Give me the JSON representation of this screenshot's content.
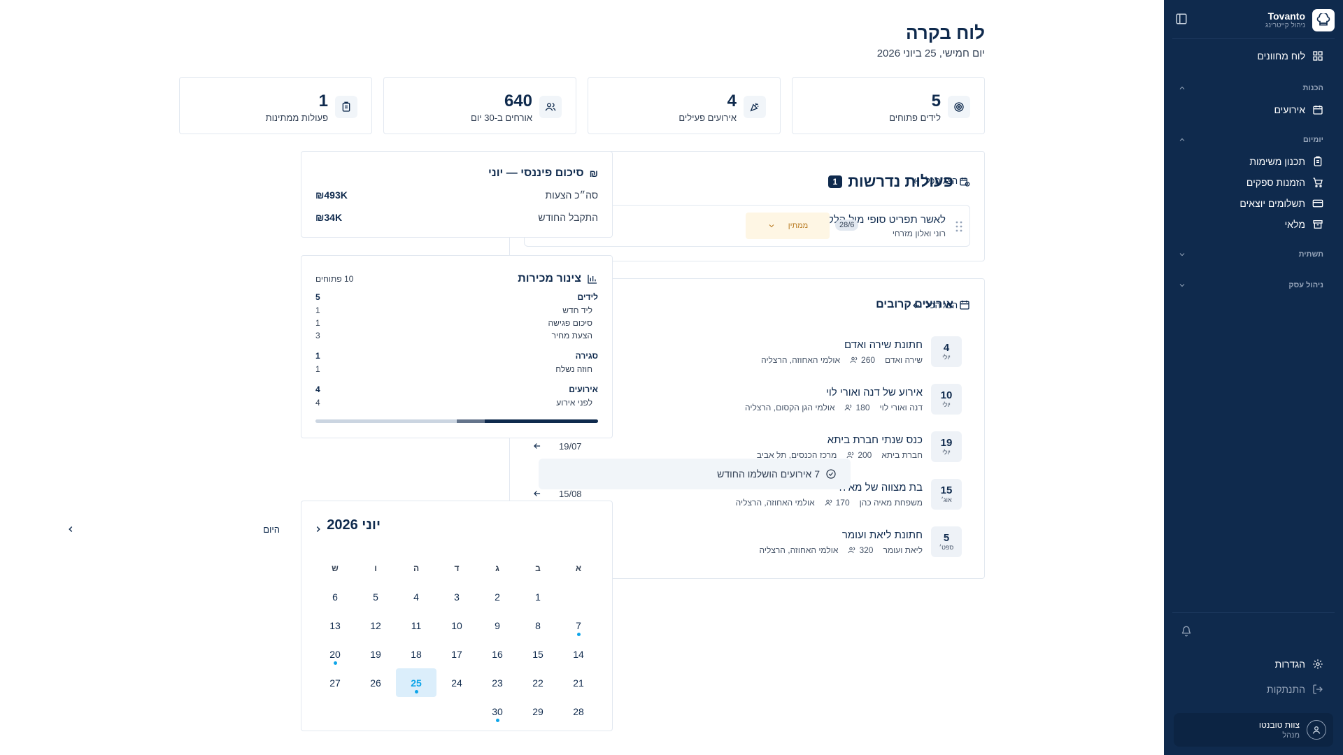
{
  "sidebar": {
    "brand_name": "Tovanto",
    "brand_sub": "ניהול קייטרינג",
    "dashboard_label": "לוח מחוונים",
    "sections": [
      {
        "title": "הכנות",
        "items": [
          {
            "label": "אירועים",
            "icon": "calendar-icon"
          }
        ]
      },
      {
        "title": "יומיום",
        "items": [
          {
            "label": "תכנון משימות",
            "icon": "clipboard-icon"
          },
          {
            "label": "הזמנות ספקים",
            "icon": "cart-icon"
          },
          {
            "label": "תשלומים יוצאים",
            "icon": "credit-card-icon"
          },
          {
            "label": "מלאי",
            "icon": "archive-icon"
          }
        ]
      },
      {
        "title": "תשתית",
        "items": []
      },
      {
        "title": "ניהול עסק",
        "items": []
      }
    ],
    "settings_label": "הגדרות",
    "logout_label": "התנתקות",
    "user_name": "צוות טובנטו",
    "user_role": "מנהל"
  },
  "header": {
    "title": "לוח בקרה",
    "date": "יום חמישי, 25 ביוני 2026"
  },
  "kpis": [
    {
      "value": "5",
      "label": "לידים פתוחים",
      "icon": "target-icon"
    },
    {
      "value": "4",
      "label": "אירועים פעילים",
      "icon": "party-popper-icon"
    },
    {
      "value": "640",
      "label": "אורחים ב-30 יום",
      "icon": "users-icon"
    },
    {
      "value": "1",
      "label": "פעולות ממתינות",
      "icon": "clipboard-icon"
    }
  ],
  "actions": {
    "title": "פעולות נדרשות",
    "count": "1",
    "show_all": "הצג הכל",
    "items": [
      {
        "title": "לאשר תפריט סופי מול הלקוח",
        "subtitle": "רוני ואלון מזרחי",
        "date": "28/6",
        "status": "ממתין"
      }
    ]
  },
  "upcoming": {
    "title": "אירועים קרובים",
    "show_all": "הצג הכל",
    "items": [
      {
        "day": "4",
        "month": "יולי",
        "title": "חתונת שירה ואדם",
        "client": "שירה ואדם",
        "guests": "260",
        "venue": "אולמי האחוזה, הרצליה",
        "date": "04/07"
      },
      {
        "day": "10",
        "month": "יולי",
        "title": "אירוע של דנה ואורי לוי",
        "client": "דנה ואורי לוי",
        "guests": "180",
        "venue": "אולמי הגן הקסום, הרצליה",
        "date": "10/07"
      },
      {
        "day": "19",
        "month": "יולי",
        "title": "כנס שנתי חברת ביתא",
        "client": "חברת ביתא",
        "guests": "200",
        "venue": "מרכז הכנסים, תל אביב",
        "date": "19/07"
      },
      {
        "day": "15",
        "month": "אוג׳",
        "title": "בת מצווה של מאיה",
        "client": "משפחת מאיה כהן",
        "guests": "170",
        "venue": "אולמי האחוזה, הרצליה",
        "date": "15/08"
      },
      {
        "day": "5",
        "month": "ספט׳",
        "title": "חתונת ליאת ועומר",
        "client": "ליאת ועומר",
        "guests": "320",
        "venue": "אולמי האחוזה, הרצליה",
        "date": "05/09"
      }
    ]
  },
  "finance": {
    "title": "סיכום פיננסי — יוני",
    "rows": [
      {
        "label": "סה״כ הצעות",
        "amount": "₪493K"
      },
      {
        "label": "התקבל החודש",
        "amount": "₪34K"
      }
    ]
  },
  "pipeline": {
    "title": "צינור מכירות",
    "open_count": "10 פתוחים",
    "groups": [
      {
        "name": "לידים",
        "total": "5",
        "items": [
          {
            "label": "ליד חדש",
            "value": "1"
          },
          {
            "label": "סיכום פגישה",
            "value": "1"
          },
          {
            "label": "הצעת מחיר",
            "value": "3"
          }
        ]
      },
      {
        "name": "סגירה",
        "total": "1",
        "items": [
          {
            "label": "חוזה נשלח",
            "value": "1"
          }
        ]
      },
      {
        "name": "אירועים",
        "total": "4",
        "items": [
          {
            "label": "לפני אירוע",
            "value": "4"
          }
        ]
      }
    ],
    "progress": {
      "leads": 0.5,
      "closing": 0.1,
      "events": 0.4
    }
  },
  "completed": {
    "text": "7 אירועים הושלמו החודש"
  },
  "calendar": {
    "month_label": "יוני 2026",
    "today_label": "היום",
    "weekdays": [
      "א",
      "ב",
      "ג",
      "ד",
      "ה",
      "ו",
      "ש"
    ],
    "weeks": [
      [
        "",
        "1",
        "2",
        "3",
        "4",
        "5",
        "6"
      ],
      [
        "7",
        "8",
        "9",
        "10",
        "11",
        "12",
        "13"
      ],
      [
        "14",
        "15",
        "16",
        "17",
        "18",
        "19",
        "20"
      ],
      [
        "21",
        "22",
        "23",
        "24",
        "25",
        "26",
        "27"
      ],
      [
        "28",
        "29",
        "30",
        "",
        "",
        "",
        ""
      ]
    ],
    "today": "25",
    "event_days": [
      "7",
      "20",
      "25",
      "30"
    ]
  },
  "colors": {
    "navy": "#0f2a4d",
    "accent": "#0ea5e9",
    "pending": "#b7791f"
  }
}
